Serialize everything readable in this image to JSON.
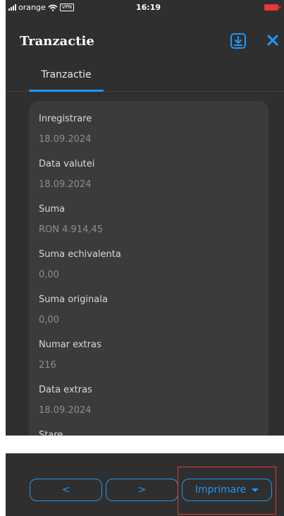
{
  "status_bar": {
    "carrier": "orange",
    "vpn": "VPN",
    "time": "16:19"
  },
  "header": {
    "title": "Tranzactie",
    "download_icon": "download-icon",
    "close_icon": "close-icon"
  },
  "tabs": [
    {
      "label": "Tranzactie"
    }
  ],
  "details": [
    {
      "label": "Inregistrare",
      "value": "18.09.2024"
    },
    {
      "label": "Data valutei",
      "value": "18.09.2024"
    },
    {
      "label": "Suma",
      "value": "RON 4.914,45"
    },
    {
      "label": "Suma echivalenta",
      "value": "0,00"
    },
    {
      "label": "Suma originala",
      "value": "0,00"
    },
    {
      "label": "Numar extras",
      "value": "216"
    },
    {
      "label": "Data extras",
      "value": "18.09.2024"
    },
    {
      "label": "Stare",
      "value": ""
    }
  ],
  "footer": {
    "prev_label": "<",
    "next_label": ">",
    "print_label": "Imprimare"
  },
  "colors": {
    "accent": "#2196f3",
    "background": "#2f2f2f",
    "card": "#3b3b3b",
    "highlight": "#e53935"
  }
}
